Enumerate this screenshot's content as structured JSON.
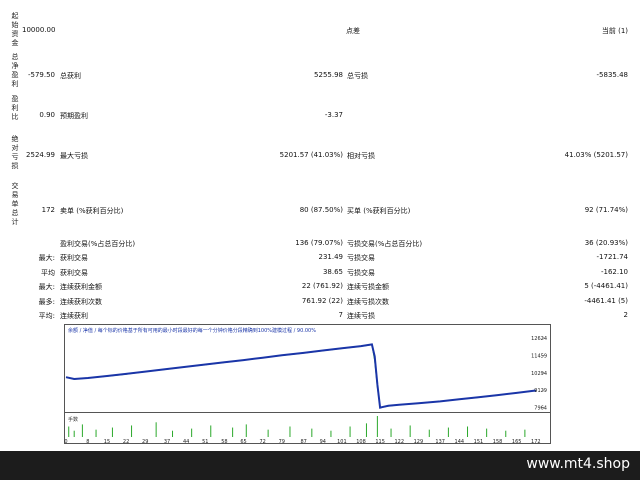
{
  "report": {
    "initial_deposit": "10000.00",
    "spread_label": "点差",
    "spread_value": "当前 (1)",
    "total_net_profit": "-579.50",
    "gross_profit_label": "总获利",
    "gross_profit": "5255.98",
    "gross_loss_label": "总亏损",
    "gross_loss": "-5835.48",
    "profit_factor": "0.90",
    "expected_payoff_label": "预期盈利",
    "expected_payoff": "-3.37",
    "absolute_drawdown": "2524.99",
    "max_drawdown_label": "最大亏损",
    "max_drawdown": "5201.57 (41.03%)",
    "relative_drawdown_label": "相对亏损",
    "relative_drawdown": "41.03% (5201.57)",
    "total_trades": "172",
    "short_label": "卖单 (%获利百分比)",
    "short_value": "80 (87.50%)",
    "long_label": "买单 (%获利百分比)",
    "long_value": "92 (71.74%)",
    "profit_trades_label": "盈利交易(%占总百分比)",
    "profit_trades": "136 (79.07%)",
    "loss_trades_label": "亏损交易(%占总百分比)",
    "loss_trades": "36 (20.93%)",
    "largest_row_label": "最大:",
    "largest_profit_label": "获利交易",
    "largest_profit": "231.49",
    "largest_loss_label": "亏损交易",
    "largest_loss": "-1721.74",
    "average_row_label": "平均",
    "avg_profit_label": "获利交易",
    "avg_profit": "38.65",
    "avg_loss_label": "亏损交易",
    "avg_loss": "-162.10",
    "max_row_label": "最大:",
    "max_cons_wins_label": "连续获利金额",
    "max_cons_wins": "22 (761.92)",
    "max_cons_losses_label": "连续亏损金额",
    "max_cons_losses": "5 (-4461.41)",
    "most_row_label": "最多:",
    "max_cons_profit_label": "连续获利次数",
    "max_cons_profit": "761.92 (22)",
    "max_cons_loss_label": "连续亏损次数",
    "max_cons_loss": "-4461.41 (5)",
    "avg_row_label": "平均:",
    "avg_cons_wins_label": "连续获利",
    "avg_cons_wins": "7",
    "avg_cons_losses_label": "连续亏损",
    "avg_cons_losses": "2"
  },
  "side_labels": {
    "deposit": "起始资金",
    "net_profit": "总净盈利",
    "profit_factor": "盈利比",
    "abs_drawdown": "绝对亏损",
    "trades": "交易单总计"
  },
  "chart_data": {
    "type": "line",
    "legend": "余额 / 净值 / 每个标的价格基于所有可用的最小时段最好的每一个分钟价格分段精确到100%建模过程 / 90.00%",
    "volume_label": "手数",
    "yticks": [
      12624,
      11459,
      10294,
      9129,
      7964
    ],
    "ylim": [
      7800,
      12900
    ],
    "xlim": [
      0,
      175
    ],
    "xticks": [
      0,
      8,
      15,
      22,
      29,
      37,
      44,
      51,
      58,
      65,
      72,
      79,
      87,
      94,
      101,
      108,
      115,
      122,
      129,
      137,
      144,
      151,
      158,
      165,
      172
    ],
    "balance": {
      "x": [
        0,
        3,
        8,
        15,
        22,
        29,
        37,
        44,
        51,
        58,
        65,
        72,
        79,
        87,
        94,
        101,
        108,
        112,
        113,
        114,
        115,
        118,
        122,
        129,
        137,
        144,
        151,
        158,
        165,
        172
      ],
      "y": [
        10000,
        9880,
        9950,
        10080,
        10220,
        10380,
        10550,
        10700,
        10850,
        11000,
        11150,
        11310,
        11470,
        11630,
        11790,
        11950,
        12090,
        12200,
        11400,
        9500,
        7964,
        8080,
        8150,
        8250,
        8380,
        8520,
        8650,
        8800,
        8950,
        9110
      ]
    },
    "equity": {
      "x": [
        0,
        3,
        8,
        15,
        22,
        29,
        37,
        44,
        51,
        58,
        65,
        72,
        79,
        87,
        94,
        101,
        108,
        112,
        113,
        114,
        115,
        118,
        122,
        129,
        137,
        144,
        151,
        158,
        165,
        172
      ],
      "y": [
        10000,
        9860,
        9940,
        10070,
        10200,
        10370,
        10540,
        10690,
        10840,
        10990,
        11140,
        11300,
        11460,
        11620,
        11780,
        11930,
        12070,
        12180,
        11100,
        9300,
        7964,
        8060,
        8140,
        8240,
        8370,
        8510,
        8640,
        8790,
        8940,
        9100
      ]
    },
    "volume_bars": [
      {
        "x": 1,
        "h": 0.5
      },
      {
        "x": 3,
        "h": 0.3
      },
      {
        "x": 6,
        "h": 0.6
      },
      {
        "x": 11,
        "h": 0.35
      },
      {
        "x": 17,
        "h": 0.45
      },
      {
        "x": 24,
        "h": 0.55
      },
      {
        "x": 33,
        "h": 0.7
      },
      {
        "x": 39,
        "h": 0.3
      },
      {
        "x": 46,
        "h": 0.4
      },
      {
        "x": 53,
        "h": 0.55
      },
      {
        "x": 61,
        "h": 0.45
      },
      {
        "x": 66,
        "h": 0.6
      },
      {
        "x": 74,
        "h": 0.35
      },
      {
        "x": 82,
        "h": 0.5
      },
      {
        "x": 90,
        "h": 0.4
      },
      {
        "x": 97,
        "h": 0.3
      },
      {
        "x": 104,
        "h": 0.5
      },
      {
        "x": 110,
        "h": 0.65
      },
      {
        "x": 114,
        "h": 1.0
      },
      {
        "x": 119,
        "h": 0.4
      },
      {
        "x": 126,
        "h": 0.55
      },
      {
        "x": 133,
        "h": 0.35
      },
      {
        "x": 140,
        "h": 0.45
      },
      {
        "x": 147,
        "h": 0.5
      },
      {
        "x": 154,
        "h": 0.4
      },
      {
        "x": 161,
        "h": 0.3
      },
      {
        "x": 168,
        "h": 0.35
      }
    ],
    "colors": {
      "balance": "#1a35a8",
      "equity": "#2aa82a",
      "volume": "#2aa82a"
    }
  },
  "footer": {
    "watermark": "www.mt4.shop"
  }
}
